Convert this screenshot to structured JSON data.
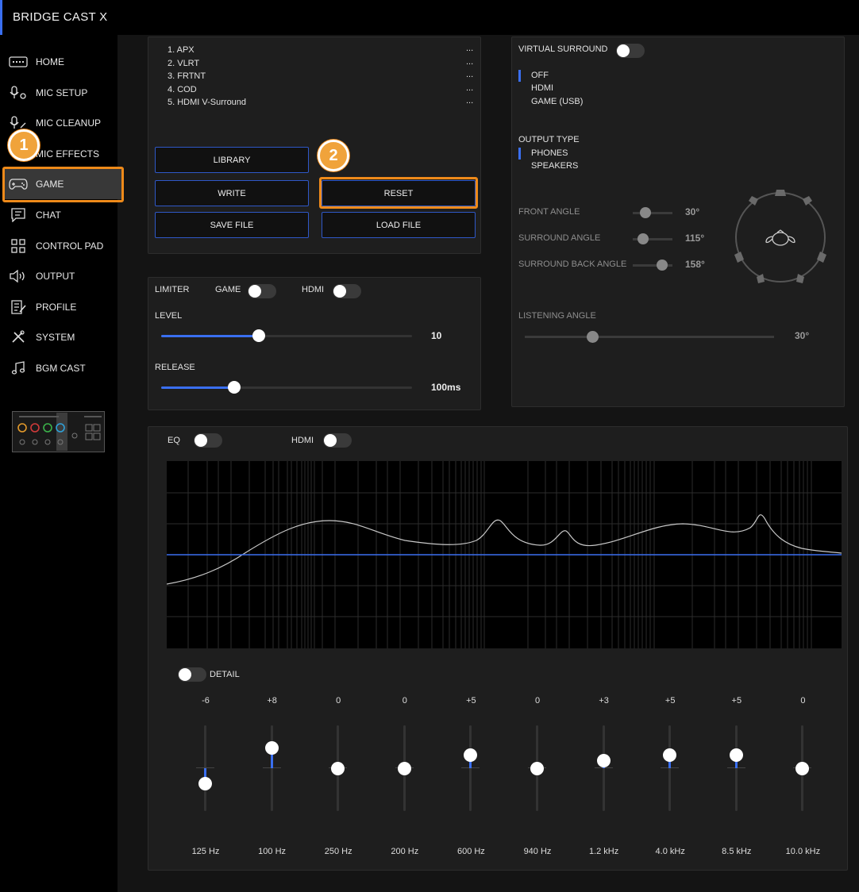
{
  "app": {
    "title": "BRIDGE CAST X"
  },
  "sidebar": {
    "items": [
      {
        "label": "HOME",
        "icon": "home-icon"
      },
      {
        "label": "MIC SETUP",
        "icon": "mic-setup-icon"
      },
      {
        "label": "MIC CLEANUP",
        "icon": "mic-cleanup-icon"
      },
      {
        "label": "MIC EFFECTS",
        "icon": "mic-effects-icon"
      },
      {
        "label": "GAME",
        "icon": "gamepad-icon",
        "active": true
      },
      {
        "label": "CHAT",
        "icon": "chat-icon"
      },
      {
        "label": "CONTROL PAD",
        "icon": "control-pad-icon"
      },
      {
        "label": "OUTPUT",
        "icon": "speaker-icon"
      },
      {
        "label": "PROFILE",
        "icon": "profile-icon"
      },
      {
        "label": "SYSTEM",
        "icon": "tools-icon"
      },
      {
        "label": "BGM CAST",
        "icon": "music-note-icon"
      }
    ],
    "device_image": "bridge-cast-device-thumbnail"
  },
  "callouts": {
    "one": "1",
    "two": "2"
  },
  "presets": {
    "items": [
      {
        "label": "1. APX",
        "more": "..."
      },
      {
        "label": "2. VLRT",
        "more": "..."
      },
      {
        "label": "3. FRTNT",
        "more": "..."
      },
      {
        "label": "4. COD",
        "more": "..."
      },
      {
        "label": "5. HDMI V-Surround",
        "more": "..."
      }
    ],
    "buttons": {
      "library": "LIBRARY",
      "write": "WRITE",
      "reset": "RESET",
      "save_file": "SAVE FILE",
      "load_file": "LOAD FILE"
    }
  },
  "limiter": {
    "label": "LIMITER",
    "game_label": "GAME",
    "hdmi_label": "HDMI",
    "game_on": false,
    "hdmi_on": false,
    "level": {
      "label": "LEVEL",
      "value": "10",
      "fraction": 0.39
    },
    "release": {
      "label": "RELEASE",
      "value": "100ms",
      "fraction": 0.29
    }
  },
  "surround": {
    "label": "VIRTUAL SURROUND",
    "enabled": false,
    "modes": [
      "OFF",
      "HDMI",
      "GAME (USB)"
    ],
    "selected_mode": "OFF",
    "output_type_label": "OUTPUT TYPE",
    "output_types": [
      "PHONES",
      "SPEAKERS"
    ],
    "selected_output": "PHONES",
    "front_angle": {
      "label": "FRONT ANGLE",
      "value": "30°"
    },
    "surround_angle": {
      "label": "SURROUND ANGLE",
      "value": "115°"
    },
    "surround_back_angle": {
      "label": "SURROUND BACK ANGLE",
      "value": "158°"
    },
    "listening_angle": {
      "label": "LISTENING ANGLE",
      "value": "30°"
    }
  },
  "eq": {
    "label": "EQ",
    "hdmi_label": "HDMI",
    "eq_on": false,
    "hdmi_on": false,
    "detail_label": "DETAIL",
    "detail_on": false,
    "bands": [
      {
        "value": "-6",
        "gain": -6,
        "freq": "125 Hz"
      },
      {
        "value": "+8",
        "gain": 8,
        "freq": "100 Hz"
      },
      {
        "value": "0",
        "gain": 0,
        "freq": "250 Hz"
      },
      {
        "value": "0",
        "gain": 0,
        "freq": "200 Hz"
      },
      {
        "value": "+5",
        "gain": 5,
        "freq": "600 Hz"
      },
      {
        "value": "0",
        "gain": 0,
        "freq": "940 Hz"
      },
      {
        "value": "+3",
        "gain": 3,
        "freq": "1.2 kHz"
      },
      {
        "value": "+5",
        "gain": 5,
        "freq": "4.0 kHz"
      },
      {
        "value": "+5",
        "gain": 5,
        "freq": "8.5 kHz"
      },
      {
        "value": "0",
        "gain": 0,
        "freq": "10.0 kHz"
      }
    ]
  }
}
